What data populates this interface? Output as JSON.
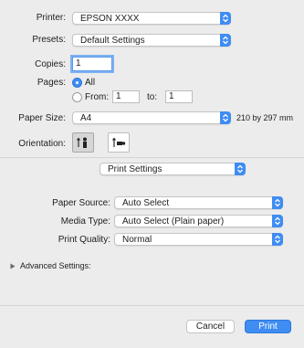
{
  "printer": {
    "label": "Printer:",
    "value": "EPSON XXXX"
  },
  "presets": {
    "label": "Presets:",
    "value": "Default Settings"
  },
  "copies": {
    "label": "Copies:",
    "value": "1"
  },
  "pages": {
    "label": "Pages:",
    "all_label": "All",
    "from_label": "From:",
    "from_value": "1",
    "to_label": "to:",
    "to_value": "1",
    "selected": "All"
  },
  "paper_size": {
    "label": "Paper Size:",
    "value": "A4",
    "dimensions": "210 by 297 mm"
  },
  "orientation": {
    "label": "Orientation:",
    "selected": "portrait"
  },
  "section_popup": {
    "value": "Print Settings"
  },
  "paper_source": {
    "label": "Paper Source:",
    "value": "Auto Select"
  },
  "media_type": {
    "label": "Media Type:",
    "value": "Auto Select (Plain paper)"
  },
  "print_quality": {
    "label": "Print Quality:",
    "value": "Normal"
  },
  "advanced": {
    "label": "Advanced Settings:",
    "expanded": false
  },
  "buttons": {
    "cancel": "Cancel",
    "print": "Print"
  },
  "colors": {
    "accent": "#3f8cf3",
    "background": "#ececec"
  },
  "icons": {
    "popup_arrows": "updown-chevron-icon",
    "disclosure": "disclosure-triangle-icon",
    "portrait": "portrait-orientation-icon",
    "landscape": "landscape-orientation-icon"
  }
}
